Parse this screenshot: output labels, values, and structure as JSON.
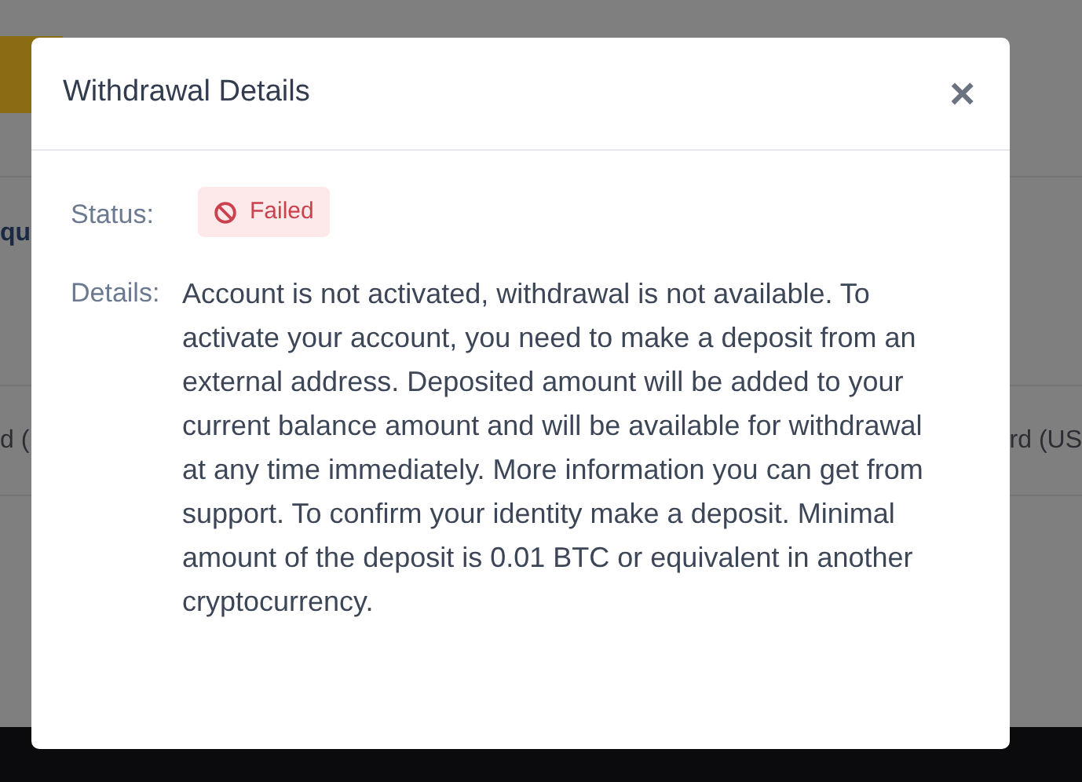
{
  "background": {
    "heading_fragment": "qu",
    "row_left_fragment": "d (",
    "row_right_fragment": "rd (US"
  },
  "dialog": {
    "title": "Withdrawal Details",
    "close": "×",
    "fields": [
      {
        "kind": "status",
        "label": "Status:",
        "value": "Failed"
      },
      {
        "kind": "text",
        "label": "Details:",
        "value": "Account is not activated, withdrawal is not available. To activate your account, you need to make a deposit from an external address. Deposited amount will be added to your current balance amount and will be available for withdrawal at any time immediately. More information you can get from support. To confirm your identity make a deposit. Minimal amount of the deposit is 0.01 BTC or equivalent in another cryptocurrency."
      }
    ]
  }
}
